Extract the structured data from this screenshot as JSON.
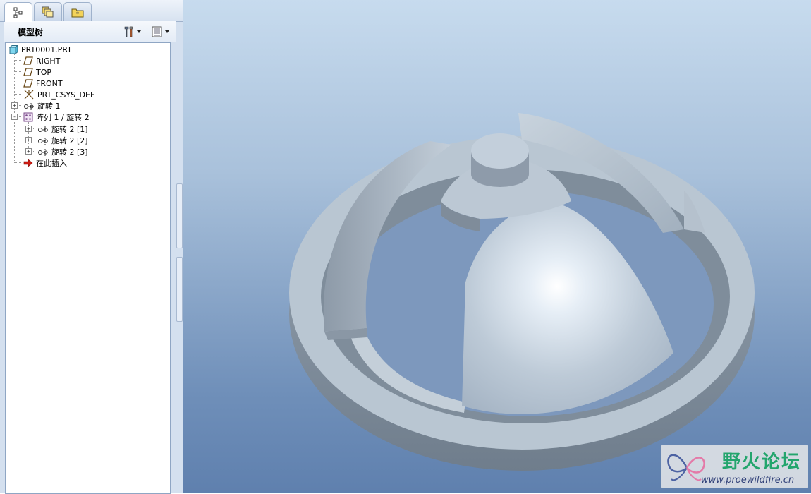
{
  "panel": {
    "tabs": [
      "model-tree-tab",
      "layer-tree-tab",
      "folder-browser-tab"
    ],
    "title": "模型树",
    "header_icons": [
      "settings-icon",
      "show-icon"
    ]
  },
  "tree": {
    "root": "PRT0001.PRT",
    "items": [
      {
        "label": "RIGHT",
        "icon": "datum-plane-icon"
      },
      {
        "label": "TOP",
        "icon": "datum-plane-icon"
      },
      {
        "label": "FRONT",
        "icon": "datum-plane-icon"
      },
      {
        "label": "PRT_CSYS_DEF",
        "icon": "coordinate-system-icon"
      },
      {
        "label": "旋转 1",
        "icon": "revolve-icon"
      },
      {
        "label": "阵列 1 / 旋转 2",
        "icon": "pattern-icon"
      },
      {
        "label": "旋转 2 [1]",
        "icon": "revolve-icon"
      },
      {
        "label": "旋转 2 [2]",
        "icon": "revolve-icon"
      },
      {
        "label": "旋转 2 [3]",
        "icon": "revolve-icon"
      },
      {
        "label": "在此插入",
        "icon": "insert-here-arrow-icon"
      }
    ]
  },
  "watermark": {
    "name": "野火论坛",
    "url": "www.proewildfire.cn"
  },
  "colors": {
    "viewport_top": "#c7dbee",
    "viewport_bottom": "#5f80ae",
    "part_surface": "#b9c6d2",
    "watermark_green": "#23a56d"
  }
}
